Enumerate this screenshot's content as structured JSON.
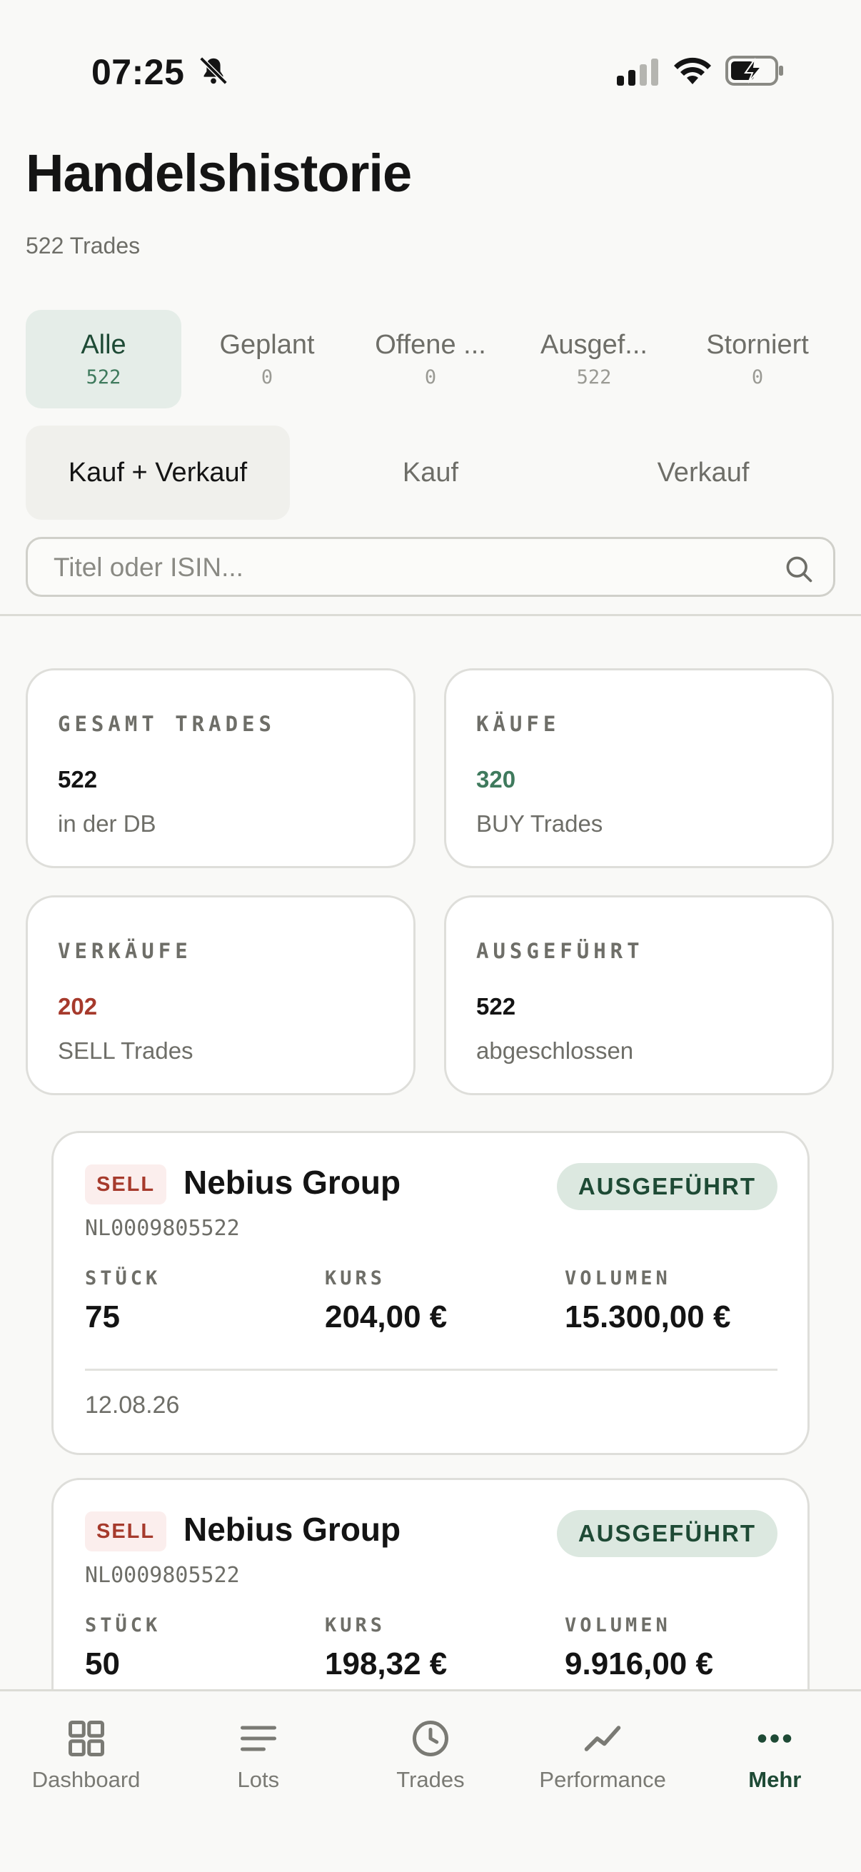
{
  "status_bar": {
    "time": "07:25"
  },
  "header": {
    "title": "Handelshistorie",
    "subtitle": "522 Trades"
  },
  "status_tabs": [
    {
      "label": "Alle",
      "count": "522"
    },
    {
      "label": "Geplant",
      "count": "0"
    },
    {
      "label": "Offene ...",
      "count": "0"
    },
    {
      "label": "Ausgef...",
      "count": "522"
    },
    {
      "label": "Storniert",
      "count": "0"
    }
  ],
  "side_filter": [
    "Kauf + Verkauf",
    "Kauf",
    "Verkauf"
  ],
  "search": {
    "placeholder": "Titel oder ISIN...",
    "value": ""
  },
  "stats": [
    {
      "label": "GESAMT TRADES",
      "value": "522",
      "sub": "in der DB"
    },
    {
      "label": "KÄUFE",
      "value": "320",
      "sub": "BUY Trades",
      "value_color": "#3f7a5d"
    },
    {
      "label": "VERKÄUFE",
      "value": "202",
      "sub": "SELL Trades",
      "value_color": "#a63a2c"
    },
    {
      "label": "AUSGEFÜHRT",
      "value": "522",
      "sub": "abgeschlossen"
    }
  ],
  "trade_columns": [
    "STÜCK",
    "KURS",
    "VOLUMEN"
  ],
  "trades": [
    {
      "side": "SELL",
      "name": "Nebius Group",
      "status": "AUSGEFÜHRT",
      "isin": "NL0009805522",
      "qty": "75",
      "price": "204,00 €",
      "volume": "15.300,00 €",
      "date": "12.08.26"
    },
    {
      "side": "SELL",
      "name": "Nebius Group",
      "status": "AUSGEFÜHRT",
      "isin": "NL0009805522",
      "qty": "50",
      "price": "198,32 €",
      "volume": "9.916,00 €",
      "date": ""
    }
  ],
  "bottom_nav": [
    {
      "label": "Dashboard",
      "icon": "grid-icon"
    },
    {
      "label": "Lots",
      "icon": "list-icon"
    },
    {
      "label": "Trades",
      "icon": "clock-icon"
    },
    {
      "label": "Performance",
      "icon": "trend-icon"
    },
    {
      "label": "Mehr",
      "icon": "more-icon",
      "active": true
    }
  ],
  "colors": {
    "accent": "#1e4a35",
    "buy": "#3f7a5d",
    "sell": "#a63a2c",
    "background": "#f9f9f7"
  }
}
